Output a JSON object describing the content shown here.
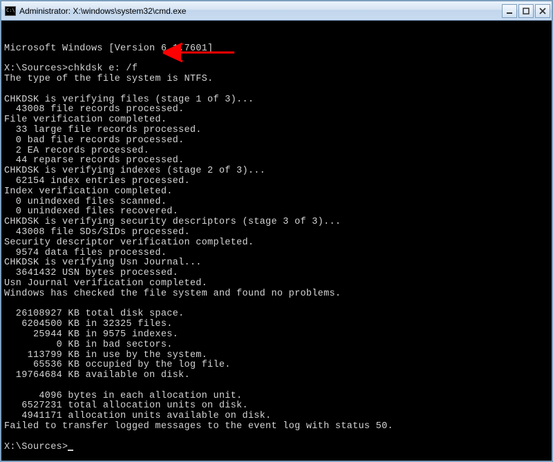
{
  "window": {
    "title": "Administrator: X:\\windows\\system32\\cmd.exe"
  },
  "console": {
    "lines": [
      "Microsoft Windows [Version 6.1.7601]",
      "",
      "X:\\Sources>chkdsk e: /f",
      "The type of the file system is NTFS.",
      "",
      "CHKDSK is verifying files (stage 1 of 3)...",
      "  43008 file records processed.",
      "File verification completed.",
      "  33 large file records processed.",
      "  0 bad file records processed.",
      "  2 EA records processed.",
      "  44 reparse records processed.",
      "CHKDSK is verifying indexes (stage 2 of 3)...",
      "  62154 index entries processed.",
      "Index verification completed.",
      "  0 unindexed files scanned.",
      "  0 unindexed files recovered.",
      "CHKDSK is verifying security descriptors (stage 3 of 3)...",
      "  43008 file SDs/SIDs processed.",
      "Security descriptor verification completed.",
      "  9574 data files processed.",
      "CHKDSK is verifying Usn Journal...",
      "  3641432 USN bytes processed.",
      "Usn Journal verification completed.",
      "Windows has checked the file system and found no problems.",
      "",
      "  26108927 KB total disk space.",
      "   6204500 KB in 32325 files.",
      "     25944 KB in 9575 indexes.",
      "         0 KB in bad sectors.",
      "    113799 KB in use by the system.",
      "     65536 KB occupied by the log file.",
      "  19764684 KB available on disk.",
      "",
      "      4096 bytes in each allocation unit.",
      "   6527231 total allocation units on disk.",
      "   4941171 allocation units available on disk.",
      "Failed to transfer logged messages to the event log with status 50.",
      "",
      "X:\\Sources>"
    ]
  },
  "annotation": {
    "arrow_color": "#ff0000"
  }
}
